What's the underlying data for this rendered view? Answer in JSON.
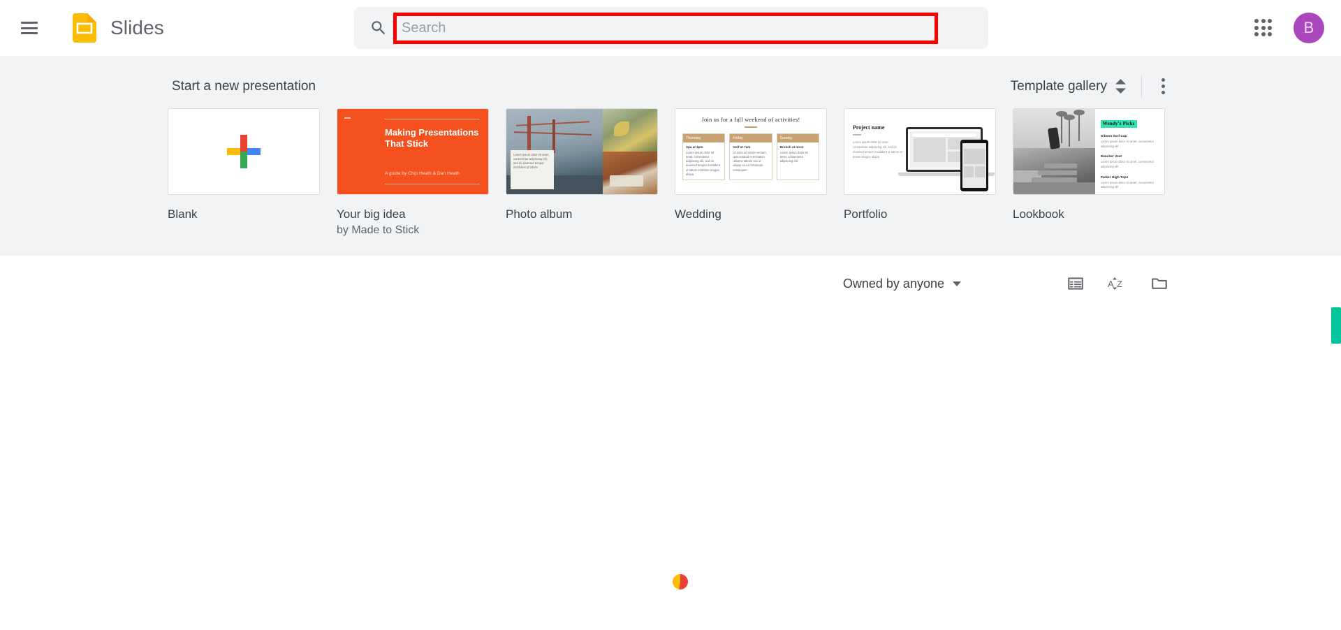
{
  "header": {
    "menu_icon": "hamburger-menu-icon",
    "logo_icon": "slides-logo-icon",
    "app_title": "Slides",
    "search": {
      "icon": "search-icon",
      "placeholder": "Search",
      "value": "",
      "highlight_color": "#ff0000"
    },
    "apps_icon": "apps-grid-icon",
    "avatar": {
      "initial": "B",
      "color": "#ab47bc"
    }
  },
  "templates": {
    "section_title": "Start a new presentation",
    "gallery_label": "Template gallery",
    "gallery_chevron_icon": "chevron-up-down-icon",
    "more_icon": "more-vert-icon",
    "items": [
      {
        "name": "Blank",
        "sub": "",
        "thumb": "blank-plus-thumbnail"
      },
      {
        "name": "Your big idea",
        "sub": "by Made to Stick",
        "thumb": "your-big-idea-thumbnail",
        "slide": {
          "title": "Making Presentations That Stick",
          "byline": "A guide by Chip Heath & Dan Heath"
        }
      },
      {
        "name": "Photo album",
        "sub": "",
        "thumb": "photo-album-thumbnail",
        "slide": {
          "caption": "Lorem ipsum dolor sit amet, consectetur adipiscing elit, sed do eiusmod tempor incididunt ut labore"
        }
      },
      {
        "name": "Wedding",
        "sub": "",
        "thumb": "wedding-thumbnail",
        "slide": {
          "title": "Join us for a full weekend of activities!",
          "columns": [
            {
              "day": "Thursday",
              "subtitle": "Spa at 4pm",
              "text": "Lorem ipsum dolor sit amet, consectetur adipiscing elit, sed do eiusmod tempor incididunt ut labore et dolore magna aliqua."
            },
            {
              "day": "Friday",
              "subtitle": "Golf at 7am",
              "text": "Ut enim ad minim veniam, quis nostrud exercitation ullamco laboris nisi ut aliquip ex ea commodo consequat."
            },
            {
              "day": "Sunday",
              "subtitle": "Brunch at noon",
              "text": "Lorem ipsum dolor sit amet, consectetur adipiscing elit"
            }
          ]
        }
      },
      {
        "name": "Portfolio",
        "sub": "",
        "thumb": "portfolio-thumbnail",
        "slide": {
          "title": "Project name",
          "text": "Lorem ipsum dolor sit amet, consectetur adipiscing elit, sed do eiusmod tempor incididunt ut labore et dolore magna aliqua"
        }
      },
      {
        "name": "Lookbook",
        "sub": "",
        "thumb": "lookbook-thumbnail",
        "slide": {
          "heading": "Wendy's Picks",
          "items": [
            {
              "title": "Gibson Surf Cap",
              "desc": "Lorem ipsum dolor sit amet, consectetur adipiscing elit"
            },
            {
              "title": "Rancher Vest",
              "desc": "Lorem ipsum dolor sit amet, consectetur adipiscing elit"
            },
            {
              "title": "Parker High-Tops",
              "desc": "Lorem ipsum dolor sit amet, consectetur adipiscing elit"
            }
          ]
        }
      }
    ]
  },
  "files": {
    "owner_filter_label": "Owned by anyone",
    "owner_filter_caret_icon": "caret-down-icon",
    "list_view_icon": "list-view-icon",
    "sort_icon": "sort-az-icon",
    "folder_icon": "folder-icon",
    "loading_spinner_icon": "loading-spinner-icon"
  },
  "scroll_indicator": {
    "icon": "scroll-thumb",
    "color": "#00c49a"
  }
}
